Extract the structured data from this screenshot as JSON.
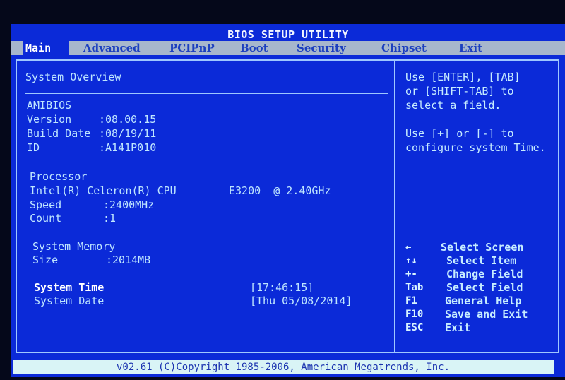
{
  "window": {
    "title": "BIOS SETUP UTILITY"
  },
  "menu": {
    "tabs": [
      {
        "label": "Main",
        "active": true
      },
      {
        "label": "Advanced"
      },
      {
        "label": "PCIPnP"
      },
      {
        "label": "Boot"
      },
      {
        "label": "Security"
      },
      {
        "label": "Chipset"
      },
      {
        "label": "Exit"
      }
    ]
  },
  "main": {
    "section_title": "System Overview",
    "bios": {
      "heading": "AMIBIOS",
      "version_label": "Version",
      "version_value": ":08.00.15",
      "build_date_label": "Build Date",
      "build_date_value": ":08/19/11",
      "id_label": "ID",
      "id_value": ":A141P010"
    },
    "processor": {
      "heading": "Processor",
      "name": "Intel(R) Celeron(R) CPU",
      "model": "E3200  @ 2.40GHz",
      "speed_label": "Speed",
      "speed_value": ":2400MHz",
      "count_label": "Count",
      "count_value": ":1"
    },
    "memory": {
      "heading": "System Memory",
      "size_label": "Size",
      "size_value": ":2014MB"
    },
    "time": {
      "label": "System Time",
      "value": "[17:46:15]"
    },
    "date": {
      "label": "System Date",
      "value": "[Thu 05/08/2014]"
    }
  },
  "help": {
    "lines": [
      "Use [ENTER], [TAB]",
      "or [SHIFT-TAB] to",
      "select a field.",
      "",
      "Use [+] or [-] to",
      "configure system Time."
    ]
  },
  "keys": [
    {
      "key": "←",
      "desc": "Select Screen"
    },
    {
      "key": "↑↓",
      "desc": "Select Item"
    },
    {
      "key": "+-",
      "desc": "Change Field"
    },
    {
      "key": "Tab",
      "desc": "Select Field"
    },
    {
      "key": "F1",
      "desc": "General Help"
    },
    {
      "key": "F10",
      "desc": "Save and Exit"
    },
    {
      "key": "ESC",
      "desc": "Exit"
    }
  ],
  "footer": {
    "text": "v02.61 (C)Copyright 1985-2006, American Megatrends, Inc."
  },
  "colors": {
    "background": "#0b2ad8",
    "menubar": "#a7b7cc",
    "text": "#bfe6ff",
    "border": "#9fc7ff",
    "footer_bg": "#d9f4f6"
  }
}
